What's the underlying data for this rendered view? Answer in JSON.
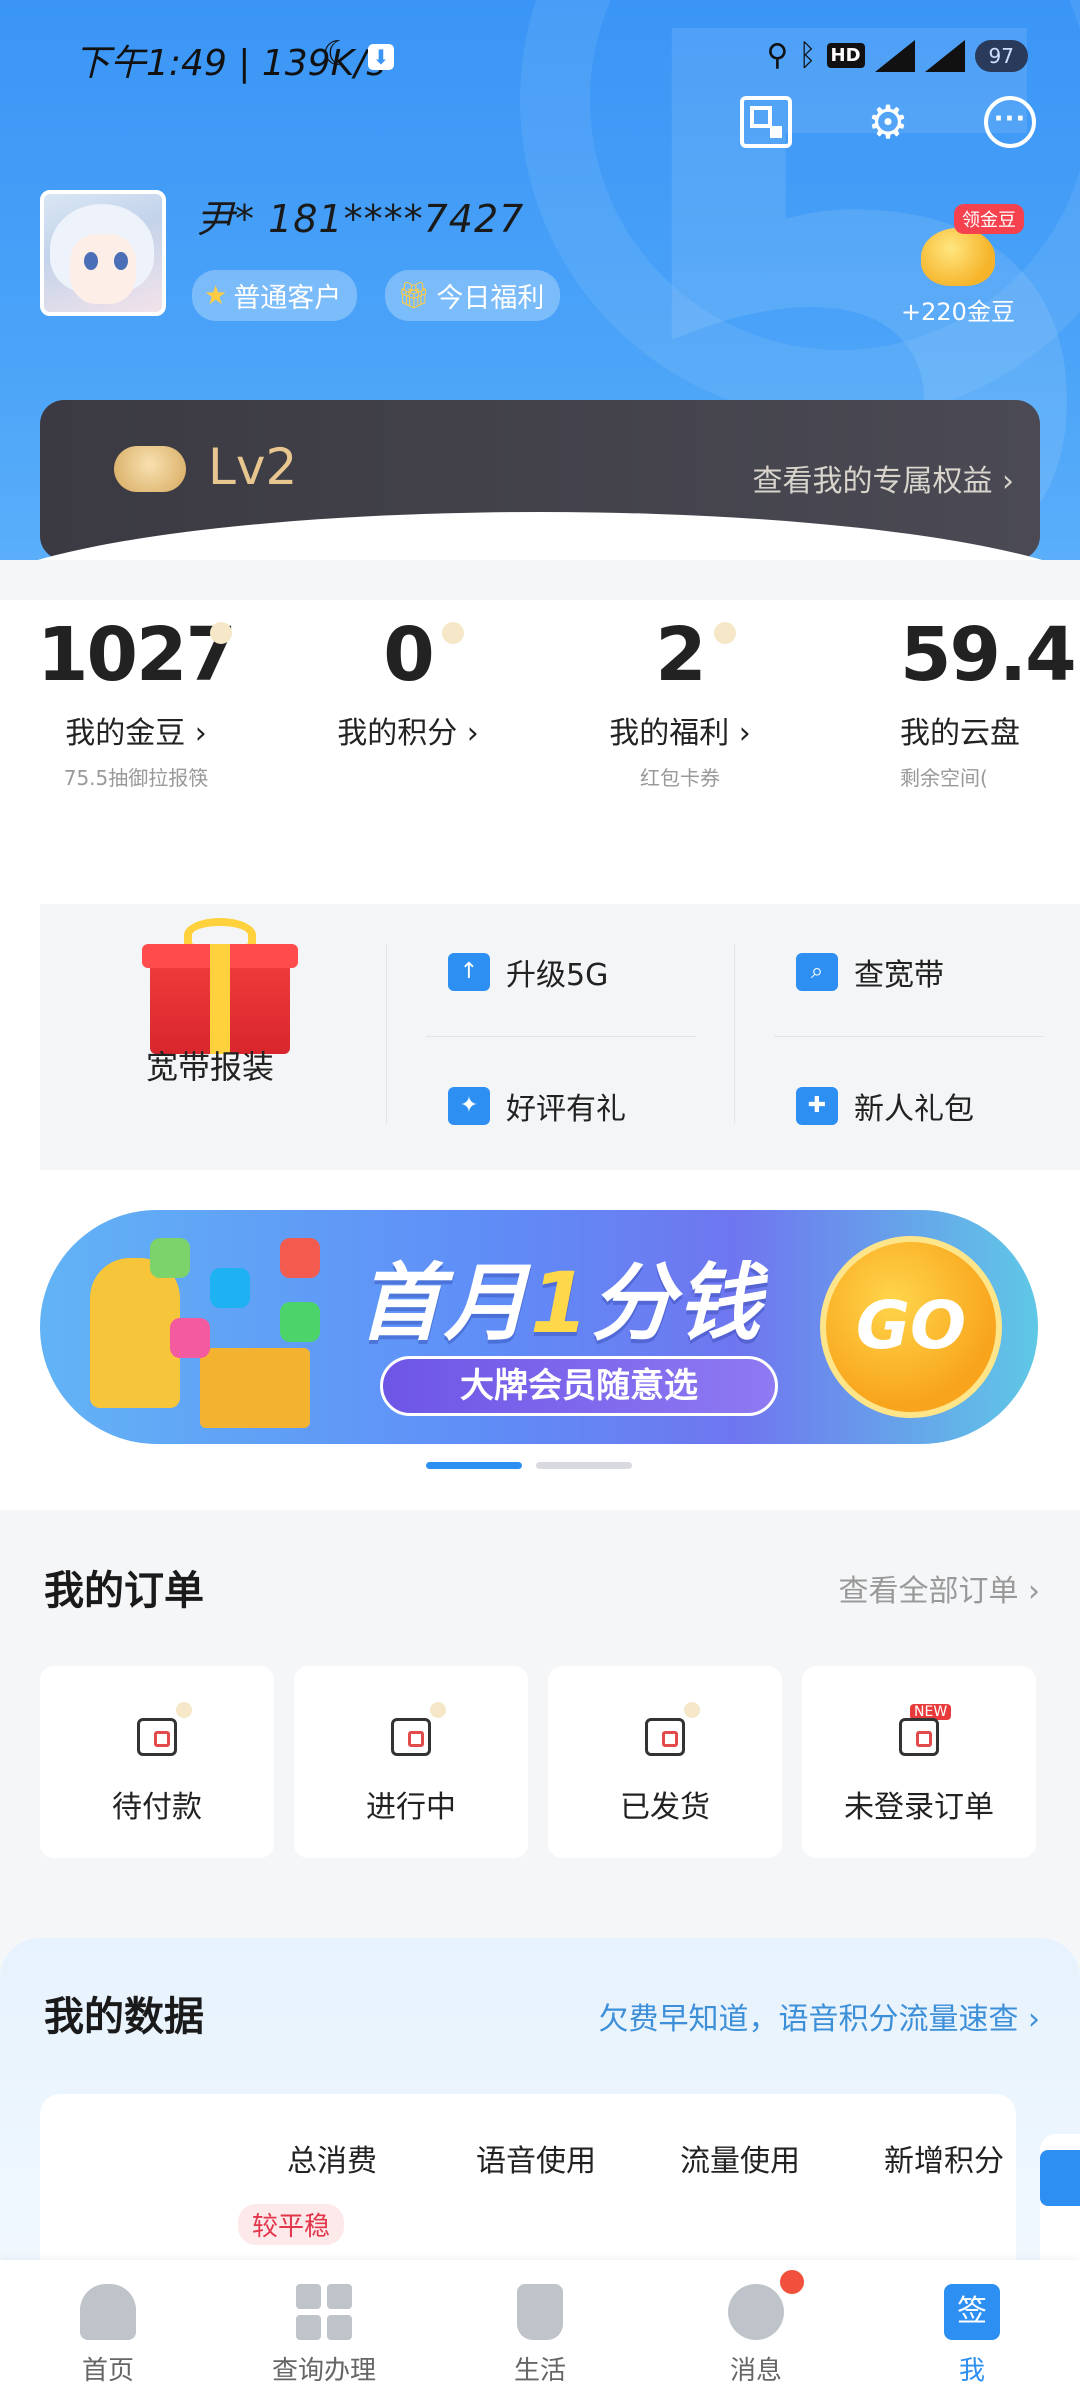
{
  "status_bar": {
    "time": "下午1:49 | 139K/s",
    "hd": "HD",
    "net1": "4G",
    "net2": "4G",
    "battery": "97"
  },
  "header": {
    "username": "尹* 181****7427",
    "tags": [
      {
        "label": "普通客户",
        "icon": "star-icon"
      },
      {
        "label": "今日福利",
        "icon": "gift-icon"
      }
    ],
    "beans_badge": "领金豆",
    "beans_text": "+220金豆",
    "icons": [
      "qr-code-icon",
      "settings-icon",
      "message-icon"
    ]
  },
  "level": {
    "name": "Lv2",
    "link": "查看我的专属权益"
  },
  "stats": [
    {
      "value": "1027",
      "label": "我的金豆",
      "sub": "75.5抽御拉报筷"
    },
    {
      "value": "0",
      "label": "我的积分",
      "sub": ""
    },
    {
      "value": "2",
      "label": "我的福利",
      "sub": "红包卡券"
    },
    {
      "value": "59.4",
      "label": "我的云盘",
      "sub": "剩余空间("
    }
  ],
  "features": {
    "big": "宽带报装",
    "items": [
      {
        "label": "升级5G",
        "icon": "upgrade-icon"
      },
      {
        "label": "查宽带",
        "icon": "router-icon"
      },
      {
        "label": "好评有礼",
        "icon": "gift-box-icon"
      },
      {
        "label": "新人礼包",
        "icon": "present-icon"
      }
    ]
  },
  "banner": {
    "title_a": "首月",
    "title_one": "1",
    "title_b": "分钱",
    "subtitle": "大牌会员随意选",
    "go": "GO"
  },
  "orders": {
    "title": "我的订单",
    "link": "查看全部订单",
    "items": [
      {
        "label": "待付款",
        "icon": "wallet-icon",
        "new": ""
      },
      {
        "label": "进行中",
        "icon": "card-icon",
        "new": ""
      },
      {
        "label": "已发货",
        "icon": "truck-icon",
        "new": ""
      },
      {
        "label": "未登录订单",
        "icon": "order-icon",
        "new": "NEW"
      }
    ]
  },
  "data": {
    "title": "我的数据",
    "link": "欠费早知道，语音积分流量速查",
    "columns": [
      "总消费",
      "语音使用",
      "流量使用",
      "新增积分"
    ],
    "badge": "较平稳"
  },
  "bottom_nav": [
    {
      "label": "首页",
      "icon": "home-icon"
    },
    {
      "label": "查询办理",
      "icon": "grid-icon"
    },
    {
      "label": "生活",
      "icon": "cup-icon"
    },
    {
      "label": "消息",
      "icon": "message-icon"
    },
    {
      "label": "我",
      "icon": "checkin-icon",
      "icon_text": "签"
    }
  ],
  "colors": {
    "primary": "#2e8ff2",
    "header_blue": "#3a95f6",
    "level_dark": "#3b3a42",
    "gold": "#e8c690",
    "red": "#f0503c"
  }
}
